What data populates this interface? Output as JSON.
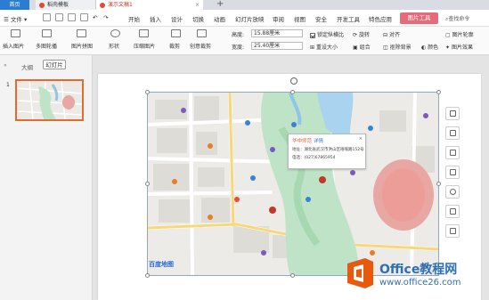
{
  "tabs": {
    "home": "首页",
    "template": "稻壳模板",
    "document": "演示文稿1",
    "add": "+"
  },
  "menu": {
    "file": "文件",
    "items": [
      "开始",
      "插入",
      "设计",
      "切换",
      "动画",
      "幻灯片放映",
      "审阅",
      "视图",
      "安全",
      "开发工具",
      "特色应用"
    ],
    "active_tool": "图片工具",
    "search": "查找命令"
  },
  "ribbon": {
    "insert_picture": "插入图片",
    "multi_crop": "多图轮播",
    "picture_stitch": "图片拼图",
    "shape": "形状",
    "compress": "压缩图片",
    "crop": "裁剪",
    "creative_crop": "创意裁剪",
    "height_label": "高度:",
    "height_value": "15.88厘米",
    "width_label": "宽度:",
    "width_value": "25.40厘米",
    "lock_ratio": "锁定纵横比",
    "reset_size": "重设大小",
    "rotate": "旋转",
    "combine": "组合",
    "align": "对齐",
    "remove_bg": "抠除背景",
    "color": "颜色",
    "outline": "图片轮廓",
    "effect": "图片效果"
  },
  "left_panel": {
    "outline_tab": "大纲",
    "slides_tab": "幻灯片",
    "slide_number": "1"
  },
  "map": {
    "popup_title": "华中师范",
    "popup_tag": "详情",
    "popup_address": "地址：湖北省武汉市洪山区珞喻路152号",
    "popup_phone": "电话：(027)67865954",
    "baidu": "百度地图"
  },
  "watermark": {
    "title": "Office教程网",
    "url": "www.office26.com"
  },
  "colors": {
    "accent": "#e66a7a",
    "tab_blue": "#2b7cd3",
    "selection": "#e56a2c",
    "watermark": "#2f6fb6"
  }
}
